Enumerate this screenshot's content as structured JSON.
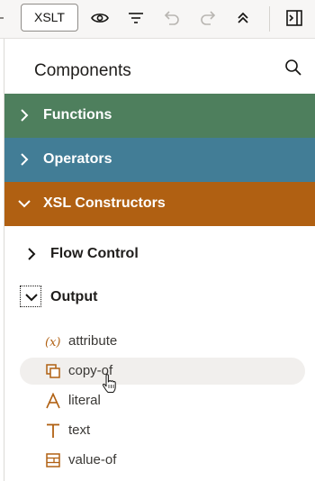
{
  "toolbar": {
    "xslt_label": "XSLT",
    "icons": [
      "eye-icon",
      "filter-icon",
      "undo-icon",
      "redo-icon",
      "collapse-all-icon",
      "panel-toggle-icon"
    ]
  },
  "panel": {
    "title": "Components",
    "search_icon": "search-icon"
  },
  "categories": [
    {
      "label": "Functions",
      "color": "#4e7f5d",
      "expanded": false
    },
    {
      "label": "Operators",
      "color": "#427d96",
      "expanded": false
    },
    {
      "label": "XSL Constructors",
      "color": "#b06012",
      "expanded": true
    }
  ],
  "subgroups": [
    {
      "label": "Flow Control",
      "expanded": false
    },
    {
      "label": "Output",
      "expanded": true
    }
  ],
  "output_items": [
    {
      "label": "attribute",
      "icon": "variable-icon"
    },
    {
      "label": "copy-of",
      "icon": "copy-icon"
    },
    {
      "label": "literal",
      "icon": "literal-icon"
    },
    {
      "label": "text",
      "icon": "text-icon"
    },
    {
      "label": "value-of",
      "icon": "value-of-icon"
    }
  ],
  "icon_color": "#b06012"
}
